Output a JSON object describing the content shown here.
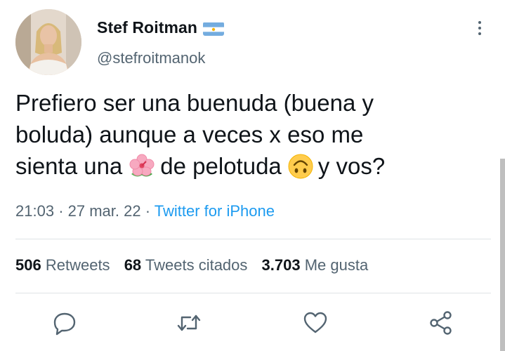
{
  "author": {
    "display_name": "Stef Roitman",
    "handle": "@stefroitmanok",
    "flag_icon": "argentina-flag-icon"
  },
  "tweet": {
    "lines": [
      "Prefiero ser una buenuda (buena y",
      "boluda) aunque a veces x eso me"
    ],
    "line3_part1": "sienta una",
    "line3_part2": "de pelotuda",
    "line3_part3": "y vos?",
    "emoji_1": "hibiscus-icon",
    "emoji_2": "upside-down-face-icon"
  },
  "meta": {
    "time": "21:03",
    "sep1": "·",
    "date": "27 mar. 22",
    "sep2": "·",
    "source": "Twitter for iPhone"
  },
  "stats": {
    "retweets_count": "506",
    "retweets_label": "Retweets",
    "quotes_count": "68",
    "quotes_label": "Tweets citados",
    "likes_count": "3.703",
    "likes_label": "Me gusta"
  },
  "colors": {
    "link": "#1d9bf0",
    "secondary_text": "#536471",
    "icon": "#536471"
  },
  "actions": [
    "reply-icon",
    "retweet-icon",
    "like-icon",
    "share-icon"
  ]
}
